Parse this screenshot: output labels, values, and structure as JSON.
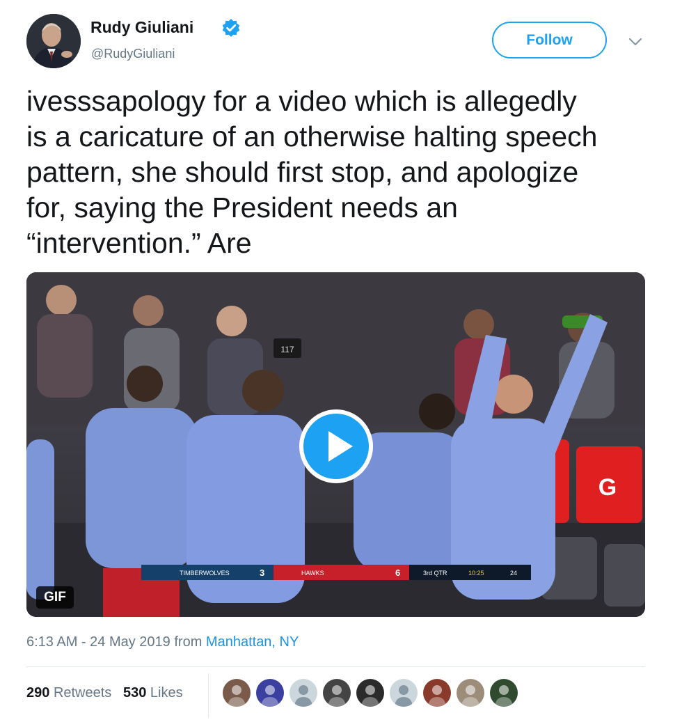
{
  "author": {
    "name": "Rudy Giuliani",
    "handle": "@RudyGiuliani",
    "verified": true
  },
  "follow_button": {
    "label": "Follow"
  },
  "tweet": {
    "lines": [
      "ivesssapology for a video which is allegedly",
      "is a caricature of an otherwise halting speech",
      "pattern, she should first stop, and apologize",
      "for, saying the President needs an",
      "“intervention.” Are"
    ]
  },
  "media": {
    "badge": "GIF",
    "scoreboard": {
      "team1": "TIMBERWOLVES",
      "score1": "3",
      "team2": "HAWKS",
      "score2": "6",
      "quarter": "3rd QTR",
      "clock": "10:25",
      "shot_clock": "24"
    },
    "overlay_number": "117"
  },
  "meta": {
    "time": "6:13 AM - 24 May 2019",
    "from_label": "from",
    "location": "Manhattan, NY"
  },
  "stats": {
    "retweets_count": "290",
    "retweets_label": "Retweets",
    "likes_count": "530",
    "likes_label": "Likes"
  },
  "likers": [
    {
      "icon": "liker-avatar-1",
      "color": "#7a5a4a"
    },
    {
      "icon": "liker-avatar-2",
      "color": "#3a3fa0"
    },
    {
      "icon": "default-avatar",
      "color": "#ccd6dd"
    },
    {
      "icon": "liker-avatar-4",
      "color": "#444444"
    },
    {
      "icon": "liker-avatar-5",
      "color": "#2b2b2b"
    },
    {
      "icon": "default-avatar",
      "color": "#ccd6dd"
    },
    {
      "icon": "liker-avatar-7",
      "color": "#8a3a2a"
    },
    {
      "icon": "liker-avatar-8",
      "color": "#9c8c7a"
    },
    {
      "icon": "liker-avatar-9",
      "color": "#2f4a2f"
    }
  ],
  "colors": {
    "accent": "#1da1f2",
    "link": "#1b95e0",
    "secondary_text": "#657786"
  }
}
